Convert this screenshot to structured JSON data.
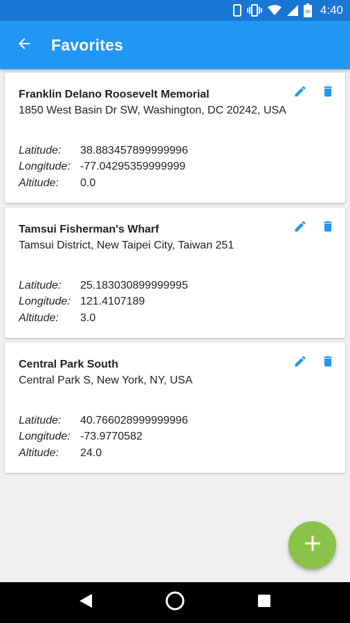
{
  "status_bar": {
    "time": "4:40",
    "battery_level": "98",
    "icons": [
      "phone-icon",
      "vibrate-icon",
      "wifi-icon",
      "signal-icon",
      "battery-icon"
    ]
  },
  "app_bar": {
    "title": "Favorites",
    "back_icon": "arrow-back-icon",
    "color": "#2196f3"
  },
  "favorites": [
    {
      "name": "Franklin Delano Roosevelt Memorial",
      "address": "1850 West Basin Dr SW, Washington, DC 20242, USA",
      "latitude_label": "Latitude:",
      "latitude": "38.883457899999996",
      "longitude_label": "Longitude:",
      "longitude": "-77.04295359999999",
      "altitude_label": "Altitude:",
      "altitude": "0.0"
    },
    {
      "name": "Tamsui Fisherman's Wharf",
      "address": "Tamsui District, New Taipei City, Taiwan 251",
      "latitude_label": "Latitude:",
      "latitude": "25.183030899999995",
      "longitude_label": "Longitude:",
      "longitude": "121.4107189",
      "altitude_label": "Altitude:",
      "altitude": "3.0"
    },
    {
      "name": "Central Park South",
      "address": "Central Park S, New York, NY, USA",
      "latitude_label": "Latitude:",
      "latitude": "40.766028999999996",
      "longitude_label": "Longitude:",
      "longitude": "-73.9770582",
      "altitude_label": "Altitude:",
      "altitude": "24.0"
    }
  ],
  "fab": {
    "icon": "plus-icon",
    "color": "#8bc34a"
  },
  "nav_bar": {
    "icons": [
      "back-triangle-icon",
      "home-circle-icon",
      "recents-square-icon"
    ]
  }
}
